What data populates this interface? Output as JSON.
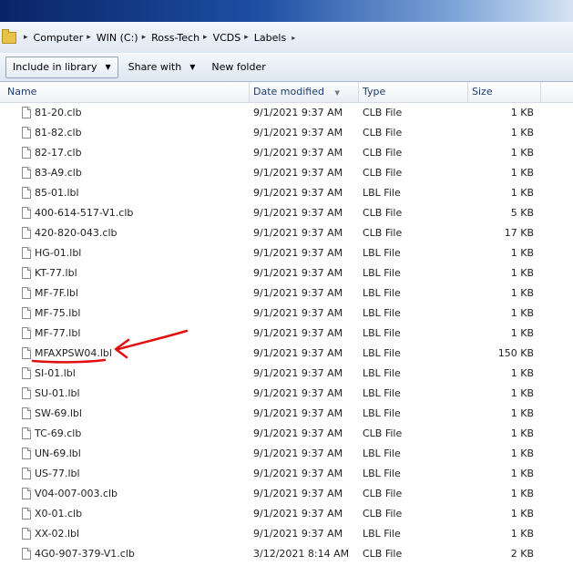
{
  "breadcrumb": [
    "Computer",
    "WIN (C:)",
    "Ross-Tech",
    "VCDS",
    "Labels"
  ],
  "toolbar": {
    "include_label": "Include in library",
    "share_label": "Share with",
    "new_folder_label": "New folder"
  },
  "columns": {
    "name": "Name",
    "date": "Date modified",
    "type": "Type",
    "size": "Size"
  },
  "files": [
    {
      "name": "81-20.clb",
      "date": "9/1/2021 9:37 AM",
      "type": "CLB File",
      "size": "1 KB"
    },
    {
      "name": "81-82.clb",
      "date": "9/1/2021 9:37 AM",
      "type": "CLB File",
      "size": "1 KB"
    },
    {
      "name": "82-17.clb",
      "date": "9/1/2021 9:37 AM",
      "type": "CLB File",
      "size": "1 KB"
    },
    {
      "name": "83-A9.clb",
      "date": "9/1/2021 9:37 AM",
      "type": "CLB File",
      "size": "1 KB"
    },
    {
      "name": "85-01.lbl",
      "date": "9/1/2021 9:37 AM",
      "type": "LBL File",
      "size": "1 KB"
    },
    {
      "name": "400-614-517-V1.clb",
      "date": "9/1/2021 9:37 AM",
      "type": "CLB File",
      "size": "5 KB"
    },
    {
      "name": "420-820-043.clb",
      "date": "9/1/2021 9:37 AM",
      "type": "CLB File",
      "size": "17 KB"
    },
    {
      "name": "HG-01.lbl",
      "date": "9/1/2021 9:37 AM",
      "type": "LBL File",
      "size": "1 KB"
    },
    {
      "name": "KT-77.lbl",
      "date": "9/1/2021 9:37 AM",
      "type": "LBL File",
      "size": "1 KB"
    },
    {
      "name": "MF-7F.lbl",
      "date": "9/1/2021 9:37 AM",
      "type": "LBL File",
      "size": "1 KB"
    },
    {
      "name": "MF-75.lbl",
      "date": "9/1/2021 9:37 AM",
      "type": "LBL File",
      "size": "1 KB"
    },
    {
      "name": "MF-77.lbl",
      "date": "9/1/2021 9:37 AM",
      "type": "LBL File",
      "size": "1 KB"
    },
    {
      "name": "MFAXPSW04.lbl",
      "date": "9/1/2021 9:37 AM",
      "type": "LBL File",
      "size": "150 KB"
    },
    {
      "name": "SI-01.lbl",
      "date": "9/1/2021 9:37 AM",
      "type": "LBL File",
      "size": "1 KB"
    },
    {
      "name": "SU-01.lbl",
      "date": "9/1/2021 9:37 AM",
      "type": "LBL File",
      "size": "1 KB"
    },
    {
      "name": "SW-69.lbl",
      "date": "9/1/2021 9:37 AM",
      "type": "LBL File",
      "size": "1 KB"
    },
    {
      "name": "TC-69.clb",
      "date": "9/1/2021 9:37 AM",
      "type": "CLB File",
      "size": "1 KB"
    },
    {
      "name": "UN-69.lbl",
      "date": "9/1/2021 9:37 AM",
      "type": "LBL File",
      "size": "1 KB"
    },
    {
      "name": "US-77.lbl",
      "date": "9/1/2021 9:37 AM",
      "type": "LBL File",
      "size": "1 KB"
    },
    {
      "name": "V04-007-003.clb",
      "date": "9/1/2021 9:37 AM",
      "type": "CLB File",
      "size": "1 KB"
    },
    {
      "name": "X0-01.clb",
      "date": "9/1/2021 9:37 AM",
      "type": "CLB File",
      "size": "1 KB"
    },
    {
      "name": "XX-02.lbl",
      "date": "9/1/2021 9:37 AM",
      "type": "LBL File",
      "size": "1 KB"
    },
    {
      "name": "4G0-907-379-V1.clb",
      "date": "3/12/2021 8:14 AM",
      "type": "CLB File",
      "size": "2 KB"
    }
  ],
  "annotation": {
    "color": "#e01010",
    "highlighted_file": "MFAXPSW04.lbl"
  }
}
